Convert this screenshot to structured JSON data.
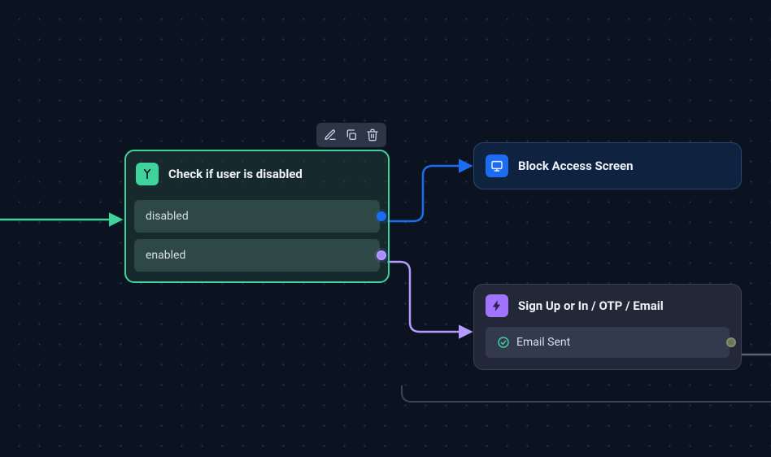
{
  "toolbar": {
    "edit_label": "Edit",
    "copy_label": "Duplicate",
    "delete_label": "Delete"
  },
  "condition_node": {
    "title": "Check if user is disabled",
    "branches": [
      {
        "label": "disabled"
      },
      {
        "label": "enabled"
      }
    ]
  },
  "block_node": {
    "title": "Block Access Screen"
  },
  "signup_node": {
    "title": "Sign Up or In / OTP / Email",
    "status": "Email Sent"
  },
  "colors": {
    "accent_green": "#3fd39b",
    "accent_blue": "#1c6cf2",
    "accent_purple": "#a88cff",
    "bg": "#0b1220"
  }
}
